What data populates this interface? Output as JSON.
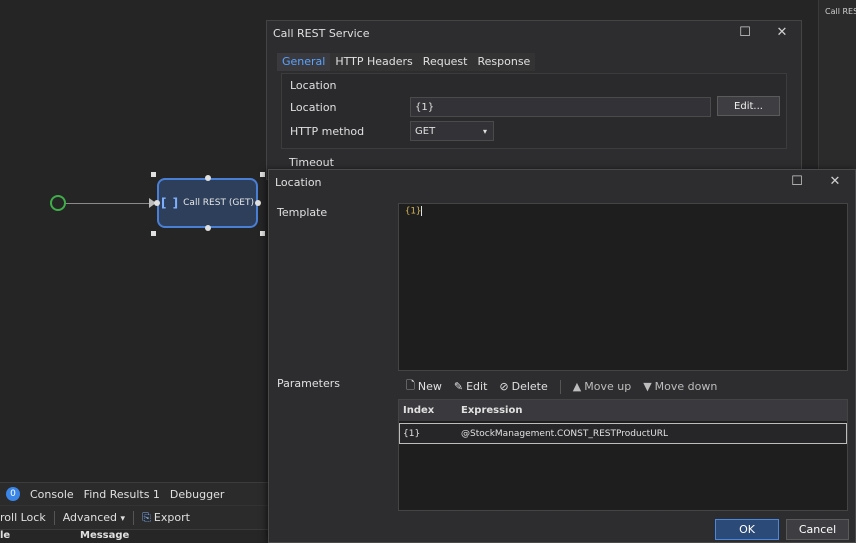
{
  "right_panel": {
    "label": "Call RES"
  },
  "workflow": {
    "activity_label": "Call REST (GET)",
    "activity_icon": "brackets-icon"
  },
  "bottom_panel": {
    "badge_count": "0",
    "tabs": [
      "Console",
      "Find Results 1",
      "Debugger"
    ],
    "toolbar": {
      "scroll_lock": "roll Lock",
      "advanced": "Advanced",
      "advanced_arrow": "▾",
      "export": "Export"
    },
    "columns": {
      "col1": "le",
      "col2": "Message"
    }
  },
  "rest_dialog": {
    "title": "Call REST Service",
    "tabs": [
      "General",
      "HTTP Headers",
      "Request",
      "Response"
    ],
    "active_tab": "General",
    "location_group": "Location",
    "location_label": "Location",
    "location_value": "{1}",
    "edit_button": "Edit...",
    "method_label": "HTTP method",
    "method_value": "GET",
    "method_arrow": "▾",
    "timeout_group": "Timeout"
  },
  "location_dialog": {
    "title": "Location",
    "template_label": "Template",
    "template_value": "{1}",
    "parameters_label": "Parameters",
    "toolbar": {
      "new": "New",
      "edit": "Edit",
      "delete": "Delete",
      "move_up": "Move up",
      "move_down": "Move down"
    },
    "table": {
      "headers": [
        "Index",
        "Expression"
      ],
      "rows": [
        {
          "index": "{1}",
          "expression": "@StockManagement.CONST_RESTProductURL"
        }
      ]
    },
    "ok": "OK",
    "cancel": "Cancel"
  },
  "colors": {
    "accent": "#4a88e0",
    "start_node": "#3fae49",
    "activity_border": "#4a7fd6"
  }
}
